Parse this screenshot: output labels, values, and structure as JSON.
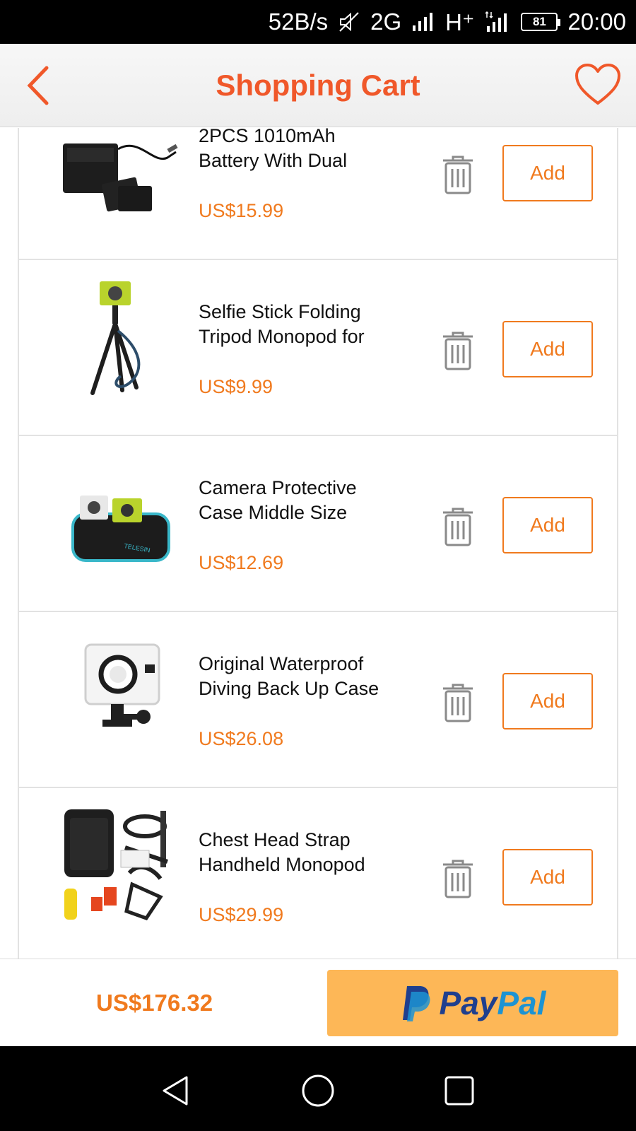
{
  "status_bar": {
    "speed": "52B/s",
    "network1": "2G",
    "network2": "H⁺",
    "battery": "81",
    "time": "20:00"
  },
  "header": {
    "title": "Shopping Cart"
  },
  "items": [
    {
      "name": "2PCS 1010mAh\nBattery With Dual",
      "price": "US$15.99",
      "add_label": "Add"
    },
    {
      "name": "Selfie Stick Folding\nTripod Monopod for",
      "price": "US$9.99",
      "add_label": "Add"
    },
    {
      "name": "Camera Protective\nCase Middle Size",
      "price": "US$12.69",
      "add_label": "Add"
    },
    {
      "name": "Original Waterproof\nDiving Back Up Case",
      "price": "US$26.08",
      "add_label": "Add"
    },
    {
      "name": "Chest Head Strap\nHandheld Monopod",
      "price": "US$29.99",
      "add_label": "Add"
    }
  ],
  "footer": {
    "total": "US$176.32",
    "paypal_pay": "Pay",
    "paypal_pal": "Pal"
  },
  "colors": {
    "accent": "#f07a1e",
    "title": "#f0582a",
    "paypal_bg": "#fdb757"
  }
}
